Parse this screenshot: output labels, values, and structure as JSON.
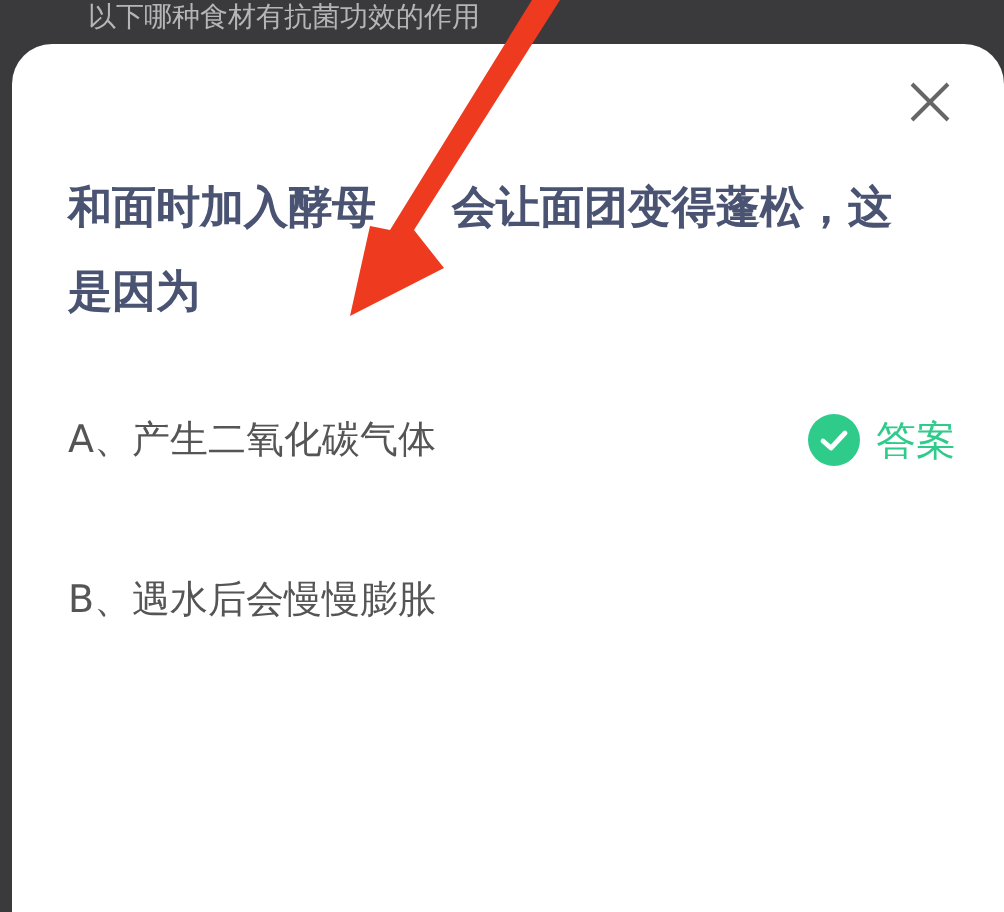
{
  "background_text": "以下哪种食材有抗菌功效的作用",
  "dialog": {
    "question_lines": [
      [
        "和面时加入酵母",
        "会让面团变得蓬松，这"
      ],
      [
        "是因为"
      ]
    ],
    "options": [
      {
        "label": "A、产生二氧化碳气体",
        "correct": true,
        "answer_label": "答案"
      },
      {
        "label": "B、遇水后会慢慢膨胀",
        "correct": false
      }
    ]
  },
  "annotation": {
    "kind": "arrow"
  }
}
